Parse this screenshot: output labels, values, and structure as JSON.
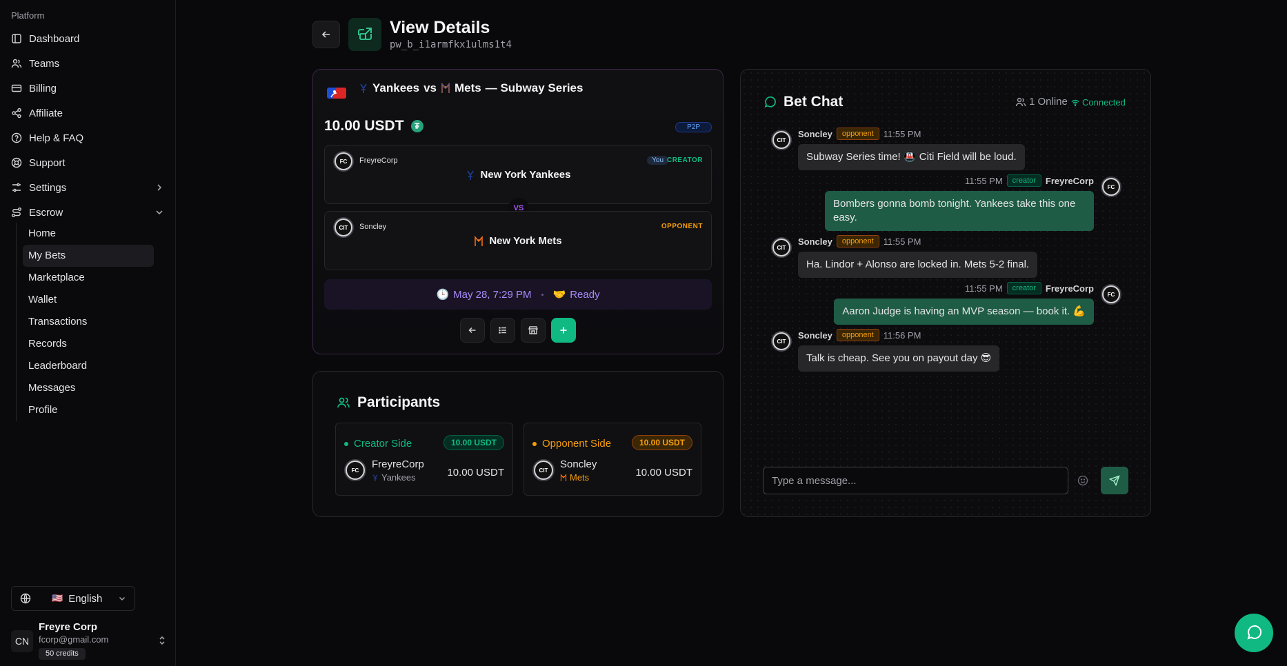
{
  "sidebar": {
    "section_label": "Platform",
    "nav": [
      {
        "label": "Dashboard",
        "icon": "dashboard-icon"
      },
      {
        "label": "Teams",
        "icon": "users-icon"
      },
      {
        "label": "Billing",
        "icon": "credit-card-icon"
      },
      {
        "label": "Affiliate",
        "icon": "share-icon"
      },
      {
        "label": "Help & FAQ",
        "icon": "help-circle-icon"
      },
      {
        "label": "Support",
        "icon": "life-buoy-icon"
      },
      {
        "label": "Settings",
        "icon": "sliders-icon"
      },
      {
        "label": "Escrow",
        "icon": "route-icon"
      }
    ],
    "escrow_items": [
      {
        "label": "Home"
      },
      {
        "label": "My Bets",
        "active": true
      },
      {
        "label": "Marketplace"
      },
      {
        "label": "Wallet"
      },
      {
        "label": "Transactions"
      },
      {
        "label": "Records"
      },
      {
        "label": "Leaderboard"
      },
      {
        "label": "Messages"
      },
      {
        "label": "Profile"
      }
    ],
    "language": {
      "flag": "🇺🇸",
      "label": "English"
    },
    "user": {
      "initials": "CN",
      "name": "Freyre Corp",
      "email": "fcorp@gmail.com",
      "credits": "50 credits"
    }
  },
  "header": {
    "title": "View Details",
    "subtitle": "pw_b_i1armfkx1ulms1t4"
  },
  "bet": {
    "team1": "Yankees",
    "vs": "vs",
    "team2": "Mets",
    "series": "— Subway Series",
    "amount": "10.00 USDT",
    "type_badge": "P2P",
    "creator": {
      "user": "FreyreCorp",
      "you": "You",
      "role": "CREATOR",
      "team": "New York Yankees",
      "avatar_text": "FC"
    },
    "vs_badge": "VS",
    "opponent": {
      "user": "Soncley",
      "role": "OPPONENT",
      "team": "New York Mets",
      "avatar_text": "CIT"
    },
    "status": {
      "date": "May 28, 7:29 PM",
      "state": "Ready",
      "clock_emoji": "🕒",
      "handshake_emoji": "🤝"
    }
  },
  "participants": {
    "title": "Participants",
    "creator_side": {
      "label": "Creator Side",
      "amount": "10.00 USDT",
      "user": "FreyreCorp",
      "team": "Yankees",
      "value": "10.00 USDT"
    },
    "opponent_side": {
      "label": "Opponent Side",
      "amount": "10.00 USDT",
      "user": "Soncley",
      "team": "Mets",
      "value": "10.00 USDT"
    }
  },
  "chat": {
    "title": "Bet Chat",
    "online": "1 Online",
    "connected": "Connected",
    "messages": [
      {
        "user": "Soncley",
        "tag": "opponent",
        "time": "11:55 PM",
        "text": "Subway Series time! 🚇 Citi Field will be loud."
      },
      {
        "user": "FreyreCorp",
        "tag": "creator",
        "time": "11:55 PM",
        "text": "Bombers gonna bomb tonight. Yankees take this one easy."
      },
      {
        "user": "Soncley",
        "tag": "opponent",
        "time": "11:55 PM",
        "text": "Ha. Lindor + Alonso are locked in. Mets 5-2 final."
      },
      {
        "user": "FreyreCorp",
        "tag": "creator",
        "time": "11:55 PM",
        "text": "Aaron Judge is having an MVP season — book it. 💪"
      },
      {
        "user": "Soncley",
        "tag": "opponent",
        "time": "11:56 PM",
        "text": "Talk is cheap. See you on payout day 😎"
      }
    ],
    "input_placeholder": "Type a message..."
  },
  "colors": {
    "accent": "#10b981",
    "opponent": "#f59e0b",
    "purple": "#a78bfa"
  }
}
